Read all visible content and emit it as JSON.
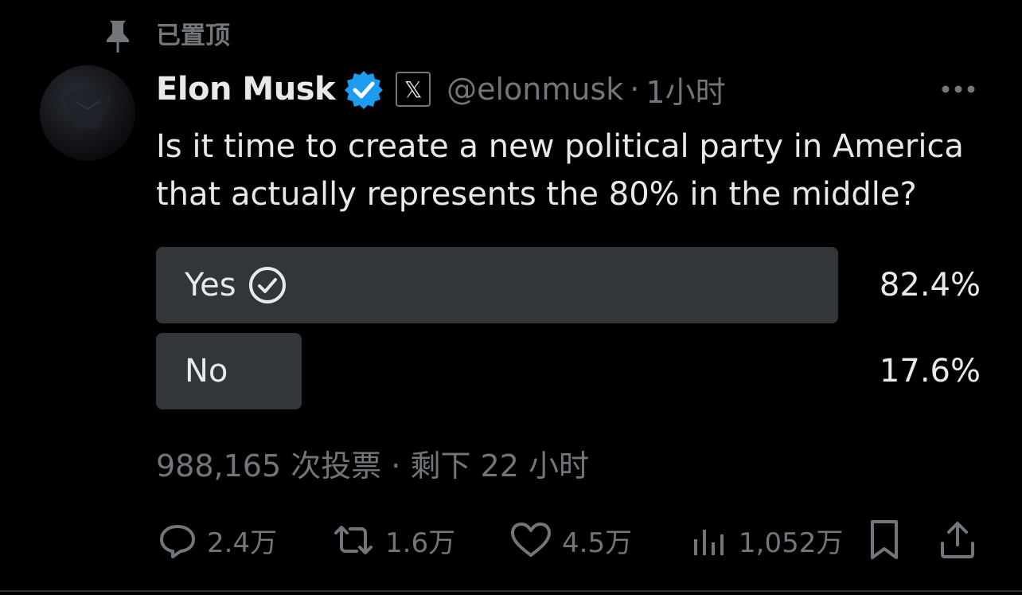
{
  "pinned": {
    "label": "已置顶"
  },
  "author": {
    "name": "Elon Musk",
    "badge": "𝕏",
    "handle": "@elonmusk",
    "separator": "·",
    "time": "1小时"
  },
  "tweet": {
    "text": "Is it time to create a new political party in America that actually represents the 80% in the middle?"
  },
  "poll": {
    "options": [
      {
        "label": "Yes",
        "percent": "82.4%",
        "fraction": 0.824,
        "selected": true
      },
      {
        "label": "No",
        "percent": "17.6%",
        "fraction": 0.176,
        "selected": false
      }
    ],
    "meta": "988,165 次投票 · 剩下 22 小时"
  },
  "actions": {
    "replies": "2.4万",
    "reposts": "1.6万",
    "likes": "4.5万",
    "views": "1,052万"
  },
  "icons": {
    "pin": "pin-icon",
    "verified": "verified-badge-icon",
    "x_logo": "x-logo-icon",
    "more": "more-horizontal-icon",
    "check": "check-circle-icon",
    "reply": "reply-icon",
    "repost": "repost-icon",
    "like": "heart-icon",
    "views": "views-chart-icon",
    "bookmark": "bookmark-icon",
    "share": "share-icon"
  },
  "colors": {
    "background": "#000000",
    "text_primary": "#e7e9ea",
    "text_secondary": "#71767b",
    "verified_blue": "#1d9bf0",
    "poll_fill": "#333639"
  }
}
